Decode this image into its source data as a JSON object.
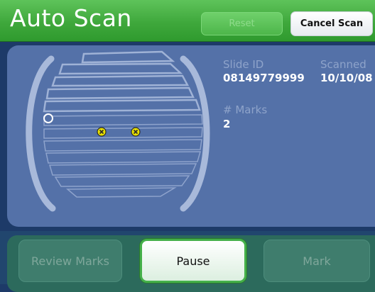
{
  "header": {
    "title": "Auto Scan",
    "reset_label": "Reset",
    "cancel_label": "Cancel Scan"
  },
  "slide": {
    "slide_id_label": "Slide ID",
    "slide_id_value": "08149779999",
    "scanned_label": "Scanned",
    "scanned_value": "10/10/08",
    "marks_label": "# Marks",
    "marks_value": "2"
  },
  "scan_map": {
    "mark_icon": "x-circle-icon",
    "cursor_icon": "circle-outline-icon",
    "mark_color": "#e8e000"
  },
  "actions": {
    "review_label": "Review Marks",
    "pause_label": "Pause",
    "mark_label": "Mark"
  },
  "colors": {
    "header_green": "#3fa83c",
    "panel_blue": "#5471a8",
    "bottom_teal": "#2c6a5c"
  }
}
